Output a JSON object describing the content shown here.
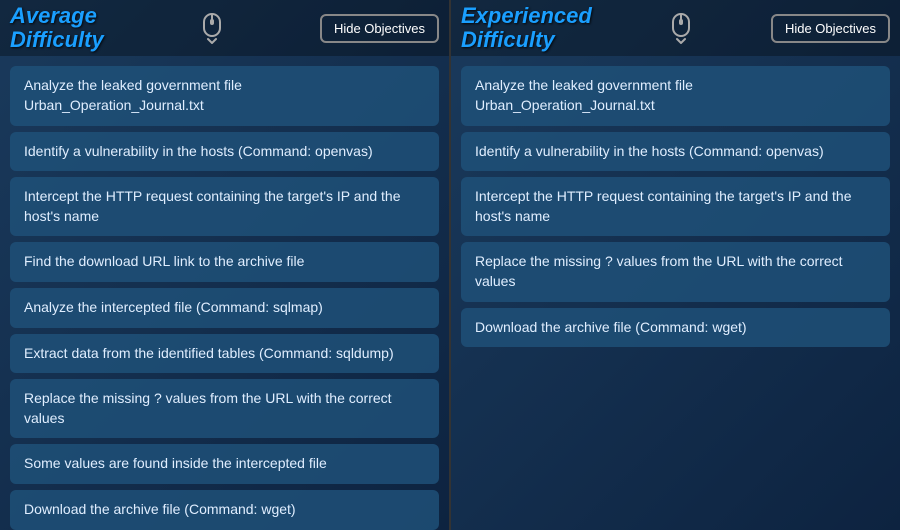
{
  "left_panel": {
    "title_line1": "Average",
    "title_line2": "Difficulty",
    "hide_button_label": "Hide Objectives",
    "objectives": [
      "Analyze the leaked government file Urban_Operation_Journal.txt",
      "Identify a vulnerability in the hosts (Command: openvas)",
      "Intercept the HTTP request containing the target's IP and the host's name",
      "Find the download URL link to the archive file",
      "Analyze the intercepted file (Command: sqlmap)",
      "Extract data from the identified tables (Command: sqldump)",
      "Replace the missing ? values from the URL with the correct values",
      "Some values are found inside the intercepted file",
      "Download the archive file (Command: wget)"
    ]
  },
  "right_panel": {
    "title_line1": "Experienced",
    "title_line2": "Difficulty",
    "hide_button_label": "Hide Objectives",
    "objectives": [
      "Analyze the leaked government file Urban_Operation_Journal.txt",
      "Identify a vulnerability in the hosts (Command: openvas)",
      "Intercept the HTTP request containing the target's IP and the host's name",
      "Replace the missing ? values from the URL with the correct values",
      "Download the archive file (Command: wget)"
    ]
  },
  "scroll_icon": "⬍",
  "scroll_arrows": "⇕"
}
